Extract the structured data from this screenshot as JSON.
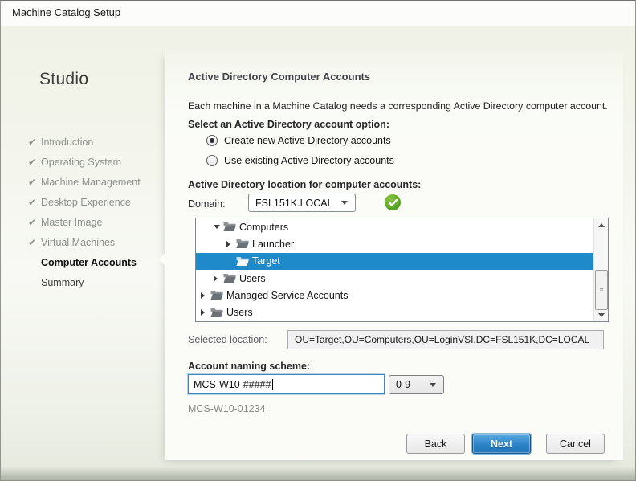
{
  "window": {
    "title": "Machine Catalog Setup"
  },
  "sidebar": {
    "brand": "Studio",
    "steps": [
      {
        "label": "Introduction",
        "state": "done"
      },
      {
        "label": "Operating System",
        "state": "done"
      },
      {
        "label": "Machine Management",
        "state": "done"
      },
      {
        "label": "Desktop Experience",
        "state": "done"
      },
      {
        "label": "Master Image",
        "state": "done"
      },
      {
        "label": "Virtual Machines",
        "state": "done"
      },
      {
        "label": "Computer Accounts",
        "state": "current"
      },
      {
        "label": "Summary",
        "state": "todo"
      }
    ]
  },
  "content": {
    "heading": "Active Directory Computer Accounts",
    "intro": "Each machine in a Machine Catalog needs a corresponding Active Directory computer account.",
    "option_label": "Select an Active Directory account option:",
    "options": [
      {
        "label": "Create new Active Directory accounts",
        "selected": true
      },
      {
        "label": "Use existing Active Directory accounts",
        "selected": false
      }
    ],
    "location_label": "Active Directory location for computer accounts:",
    "domain_label": "Domain:",
    "domain_value": "FSL151K.LOCAL",
    "domain_status_icon": "green-check",
    "tree_items": [
      {
        "label": "Computers",
        "level": 1,
        "state": "expanded",
        "selected": false
      },
      {
        "label": "Launcher",
        "level": 2,
        "state": "collapsed",
        "selected": false
      },
      {
        "label": "Target",
        "level": 2,
        "state": "leaf",
        "selected": true
      },
      {
        "label": "Users",
        "level": 1,
        "state": "collapsed",
        "selected": false
      },
      {
        "label": "Managed Service Accounts",
        "level": 0,
        "state": "collapsed",
        "selected": false
      },
      {
        "label": "Users",
        "level": 0,
        "state": "collapsed",
        "selected": false
      }
    ],
    "selected_location_label": "Selected location:",
    "selected_location_value": "OU=Target,OU=Computers,OU=LoginVSI,DC=FSL151K,DC=LOCAL",
    "naming_label": "Account naming scheme:",
    "naming_value": "MCS-W10-#####",
    "naming_digit_option": "0-9",
    "naming_preview": "MCS-W10-01234"
  },
  "footer": {
    "back_label": "Back",
    "next_label": "Next",
    "cancel_label": "Cancel"
  },
  "colors": {
    "selection_blue": "#1f8ac9",
    "primary_button_blue": "#2d84c8",
    "status_green": "#55a321"
  }
}
